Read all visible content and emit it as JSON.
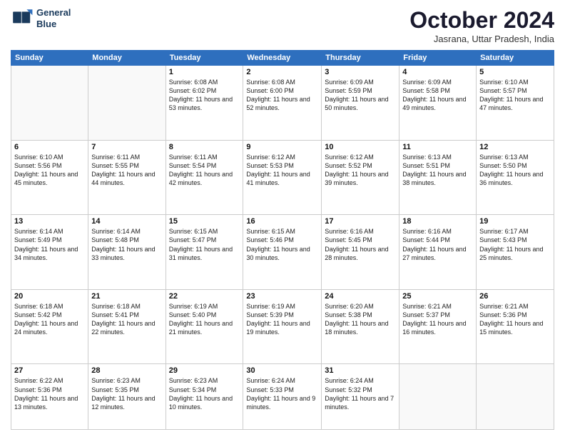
{
  "header": {
    "logo_line1": "General",
    "logo_line2": "Blue",
    "month": "October 2024",
    "location": "Jasrana, Uttar Pradesh, India"
  },
  "weekdays": [
    "Sunday",
    "Monday",
    "Tuesday",
    "Wednesday",
    "Thursday",
    "Friday",
    "Saturday"
  ],
  "weeks": [
    [
      {
        "day": "",
        "info": ""
      },
      {
        "day": "",
        "info": ""
      },
      {
        "day": "1",
        "info": "Sunrise: 6:08 AM\nSunset: 6:02 PM\nDaylight: 11 hours and 53 minutes."
      },
      {
        "day": "2",
        "info": "Sunrise: 6:08 AM\nSunset: 6:00 PM\nDaylight: 11 hours and 52 minutes."
      },
      {
        "day": "3",
        "info": "Sunrise: 6:09 AM\nSunset: 5:59 PM\nDaylight: 11 hours and 50 minutes."
      },
      {
        "day": "4",
        "info": "Sunrise: 6:09 AM\nSunset: 5:58 PM\nDaylight: 11 hours and 49 minutes."
      },
      {
        "day": "5",
        "info": "Sunrise: 6:10 AM\nSunset: 5:57 PM\nDaylight: 11 hours and 47 minutes."
      }
    ],
    [
      {
        "day": "6",
        "info": "Sunrise: 6:10 AM\nSunset: 5:56 PM\nDaylight: 11 hours and 45 minutes."
      },
      {
        "day": "7",
        "info": "Sunrise: 6:11 AM\nSunset: 5:55 PM\nDaylight: 11 hours and 44 minutes."
      },
      {
        "day": "8",
        "info": "Sunrise: 6:11 AM\nSunset: 5:54 PM\nDaylight: 11 hours and 42 minutes."
      },
      {
        "day": "9",
        "info": "Sunrise: 6:12 AM\nSunset: 5:53 PM\nDaylight: 11 hours and 41 minutes."
      },
      {
        "day": "10",
        "info": "Sunrise: 6:12 AM\nSunset: 5:52 PM\nDaylight: 11 hours and 39 minutes."
      },
      {
        "day": "11",
        "info": "Sunrise: 6:13 AM\nSunset: 5:51 PM\nDaylight: 11 hours and 38 minutes."
      },
      {
        "day": "12",
        "info": "Sunrise: 6:13 AM\nSunset: 5:50 PM\nDaylight: 11 hours and 36 minutes."
      }
    ],
    [
      {
        "day": "13",
        "info": "Sunrise: 6:14 AM\nSunset: 5:49 PM\nDaylight: 11 hours and 34 minutes."
      },
      {
        "day": "14",
        "info": "Sunrise: 6:14 AM\nSunset: 5:48 PM\nDaylight: 11 hours and 33 minutes."
      },
      {
        "day": "15",
        "info": "Sunrise: 6:15 AM\nSunset: 5:47 PM\nDaylight: 11 hours and 31 minutes."
      },
      {
        "day": "16",
        "info": "Sunrise: 6:15 AM\nSunset: 5:46 PM\nDaylight: 11 hours and 30 minutes."
      },
      {
        "day": "17",
        "info": "Sunrise: 6:16 AM\nSunset: 5:45 PM\nDaylight: 11 hours and 28 minutes."
      },
      {
        "day": "18",
        "info": "Sunrise: 6:16 AM\nSunset: 5:44 PM\nDaylight: 11 hours and 27 minutes."
      },
      {
        "day": "19",
        "info": "Sunrise: 6:17 AM\nSunset: 5:43 PM\nDaylight: 11 hours and 25 minutes."
      }
    ],
    [
      {
        "day": "20",
        "info": "Sunrise: 6:18 AM\nSunset: 5:42 PM\nDaylight: 11 hours and 24 minutes."
      },
      {
        "day": "21",
        "info": "Sunrise: 6:18 AM\nSunset: 5:41 PM\nDaylight: 11 hours and 22 minutes."
      },
      {
        "day": "22",
        "info": "Sunrise: 6:19 AM\nSunset: 5:40 PM\nDaylight: 11 hours and 21 minutes."
      },
      {
        "day": "23",
        "info": "Sunrise: 6:19 AM\nSunset: 5:39 PM\nDaylight: 11 hours and 19 minutes."
      },
      {
        "day": "24",
        "info": "Sunrise: 6:20 AM\nSunset: 5:38 PM\nDaylight: 11 hours and 18 minutes."
      },
      {
        "day": "25",
        "info": "Sunrise: 6:21 AM\nSunset: 5:37 PM\nDaylight: 11 hours and 16 minutes."
      },
      {
        "day": "26",
        "info": "Sunrise: 6:21 AM\nSunset: 5:36 PM\nDaylight: 11 hours and 15 minutes."
      }
    ],
    [
      {
        "day": "27",
        "info": "Sunrise: 6:22 AM\nSunset: 5:36 PM\nDaylight: 11 hours and 13 minutes."
      },
      {
        "day": "28",
        "info": "Sunrise: 6:23 AM\nSunset: 5:35 PM\nDaylight: 11 hours and 12 minutes."
      },
      {
        "day": "29",
        "info": "Sunrise: 6:23 AM\nSunset: 5:34 PM\nDaylight: 11 hours and 10 minutes."
      },
      {
        "day": "30",
        "info": "Sunrise: 6:24 AM\nSunset: 5:33 PM\nDaylight: 11 hours and 9 minutes."
      },
      {
        "day": "31",
        "info": "Sunrise: 6:24 AM\nSunset: 5:32 PM\nDaylight: 11 hours and 7 minutes."
      },
      {
        "day": "",
        "info": ""
      },
      {
        "day": "",
        "info": ""
      }
    ]
  ]
}
